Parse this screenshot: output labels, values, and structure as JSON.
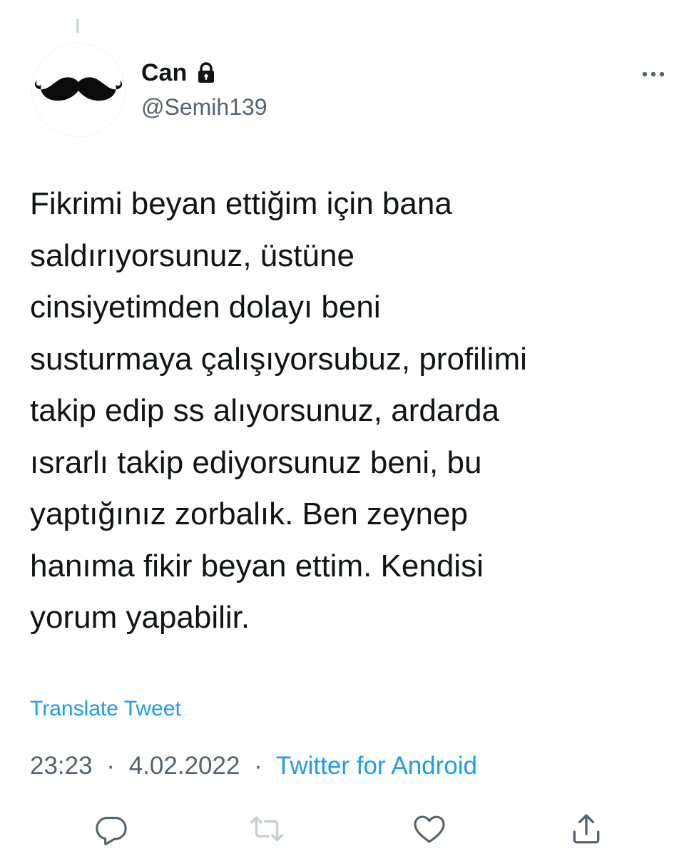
{
  "user": {
    "display_name": "Can",
    "handle": "@Semih139",
    "protected_icon": "lock-icon",
    "avatar_icon": "mustache-icon"
  },
  "header": {
    "more_icon": "more-horizontal-icon"
  },
  "tweet": {
    "text": "Fikrimi beyan ettiğim için bana\nsaldırıyorsunuz, üstüne\ncinsiyetimden dolayı beni\nsusturmaya çalışıyorsubuz, profilimi\ntakip edip ss alıyorsunuz, ardarda\nısrarlı takip ediyorsunuz beni, bu\nyaptığınız zorbalık. Ben zeynep\nhanıma fikir beyan ettim. Kendisi\nyorum yapabilir.",
    "translate_label": "Translate Tweet",
    "time": "23:23",
    "date": "4.02.2022",
    "separator": "·",
    "source": "Twitter for Android"
  },
  "actions": [
    {
      "name": "reply",
      "icon": "reply-icon"
    },
    {
      "name": "retweet",
      "icon": "retweet-icon",
      "disabled": true
    },
    {
      "name": "like",
      "icon": "heart-icon"
    },
    {
      "name": "share",
      "icon": "share-icon"
    }
  ],
  "colors": {
    "accent": "#1d9bf0",
    "text_primary": "#0f1419",
    "text_secondary": "#536471",
    "icon": "#536471",
    "icon_disabled": "#c4cfd6"
  }
}
